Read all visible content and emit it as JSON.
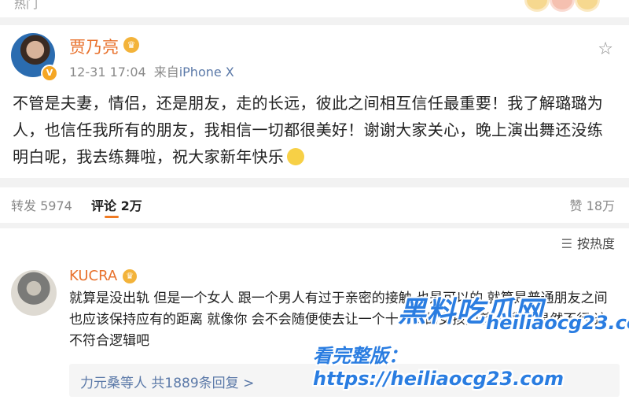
{
  "top": {
    "hot_label": "热门"
  },
  "post": {
    "author": "贾乃亮",
    "time": "12-31 17:04",
    "source_prefix": "来自",
    "source": "iPhone X",
    "text": "不管是夫妻，情侣，还是朋友，走的长远，彼此之间相互信任最重要！我了解璐璐为人，也信任我所有的朋友，我相信一切都很美好！谢谢大家关心，晚上演出舞还没练明白呢，我去练舞啦，祝大家新年快乐"
  },
  "actions": {
    "repost_label": "转发 5974",
    "comments_label": "评论 2万",
    "likes_label": "赞 18万"
  },
  "sort_label": "按热度",
  "comment": {
    "author": "KUCRA",
    "text": "就算是没出轨 但是一个女人 跟一个男人有过于亲密的接触 也是可以的 就算是普通朋友之间也应该保持应有的距离 就像你 会不会随便使去让一个十几岁的女孩挽着胳膊吗 显然不行 这不符合逻辑吧",
    "replies_label": "力元桑等人 共1889条回复 >"
  },
  "watermark": {
    "line1": "黑料吃瓜网",
    "line2": "heiliaocg23.com",
    "line3": "看完整版：https://heiliaocg23.com"
  },
  "icons": {
    "star": "star-icon",
    "sort": "sort-icon",
    "verified": "verified-badge-icon",
    "crown": "crown-icon",
    "emoji": "smile-emoji-icon"
  },
  "colors": {
    "accent": "#e8712c",
    "link": "#5b79a8",
    "watermark": "#2a7de1"
  }
}
